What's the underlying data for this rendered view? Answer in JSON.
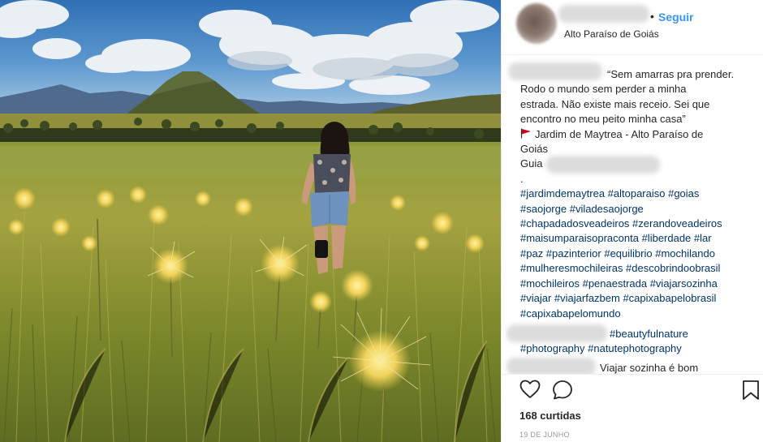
{
  "post": {
    "location": "Alto Paraíso de Goiás",
    "follow_label": "Seguir",
    "dot": "•"
  },
  "caption": {
    "lines": [
      "“Sem amarras pra prender.",
      "Rodo o mundo sem perder a minha",
      "estrada. Não existe mais receio. Sei que",
      "encontro no meu peito minha casa”",
      "Jardim de Maytrea - Alto Paraíso de",
      "Goiás",
      "Guia",
      "."
    ],
    "hashtags": [
      "#jardimdemaytrea #altoparaiso #goias",
      "#saojorge #viladesaojorge",
      "#chapadadosveadeiros #zerandoveadeiros",
      "#maisumparaisopraconta #liberdade #lar",
      "#paz #pazinterior #equilibrio #mochilando",
      "#mulheresmochileiras #descobrindoobrasil",
      "#mochileiros #penaestrada #viajarsozinha",
      "#viajar #viajarfazbem #capixabapelobrasil",
      "#capixabapelomundo"
    ]
  },
  "comments": [
    {
      "text": "#beautyfulnature"
    },
    {
      "text": "#photography #natutephotography"
    },
    {
      "text": "Viajar sozinha é bom"
    }
  ],
  "footer": {
    "likes": "168 curtidas",
    "date": "19 DE JUNHO"
  },
  "icons": {
    "like": "heart-icon",
    "comment": "comment-icon",
    "save": "bookmark-icon",
    "flag": "red-flag-icon"
  },
  "colors": {
    "link": "#3897f0",
    "hashtag": "#003569",
    "text": "#262626",
    "muted": "#999999",
    "flag": "#d0021b"
  }
}
